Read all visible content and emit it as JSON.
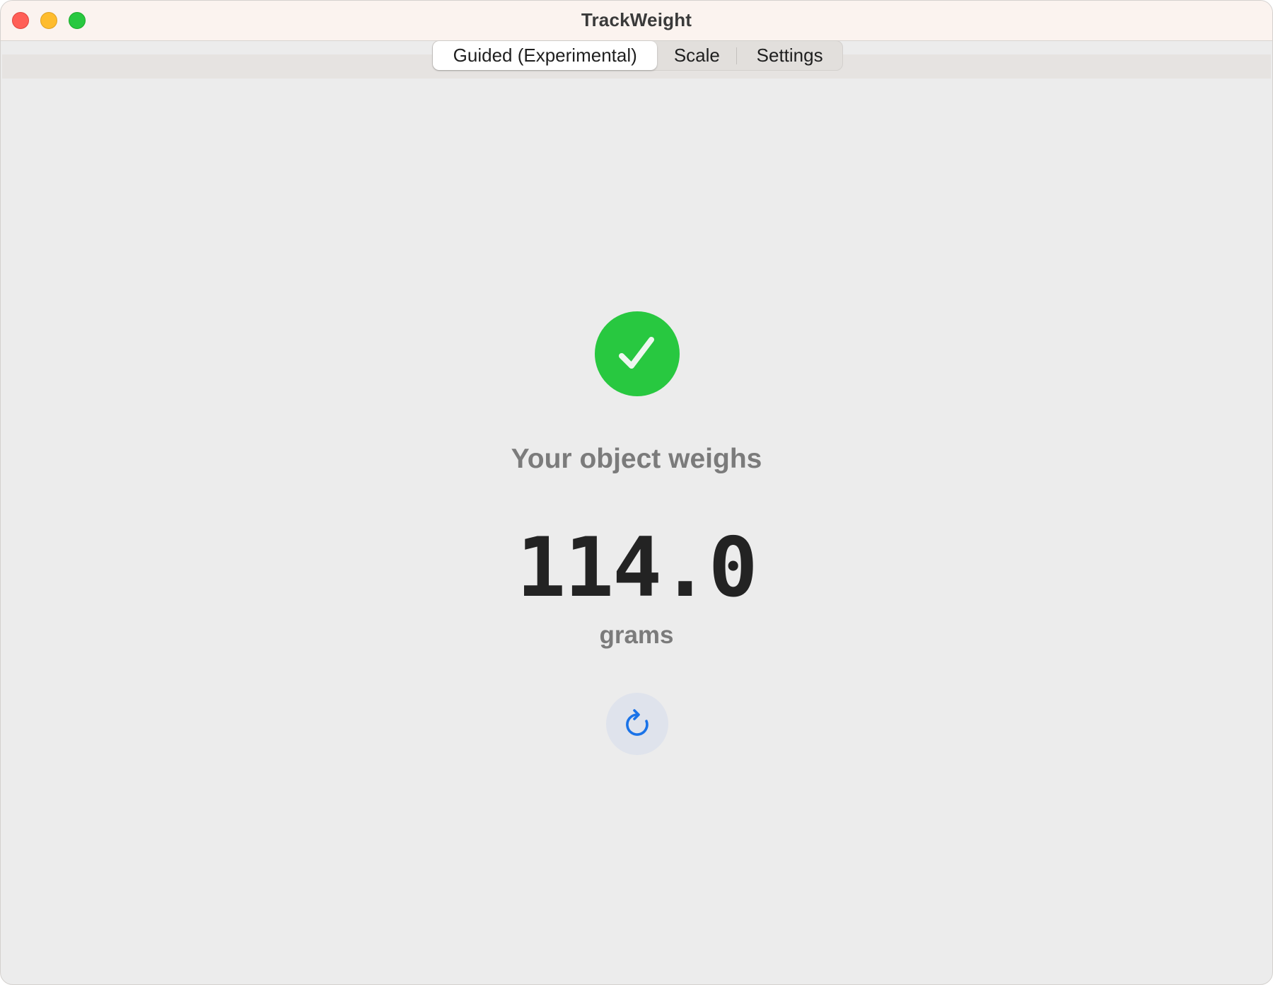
{
  "window": {
    "title": "TrackWeight"
  },
  "tabs": [
    {
      "label": "Guided (Experimental)",
      "selected": true
    },
    {
      "label": "Scale",
      "selected": false
    },
    {
      "label": "Settings",
      "selected": false
    }
  ],
  "result": {
    "status_icon": "checkmark-circle-icon",
    "headline": "Your object weighs",
    "value": "114.0",
    "unit": "grams",
    "reset_icon": "rotate-clockwise-icon"
  },
  "colors": {
    "success": "#28c840",
    "accent": "#1a73e8",
    "close": "#ff5f57",
    "minimize": "#febc2e",
    "zoom": "#28c840"
  }
}
